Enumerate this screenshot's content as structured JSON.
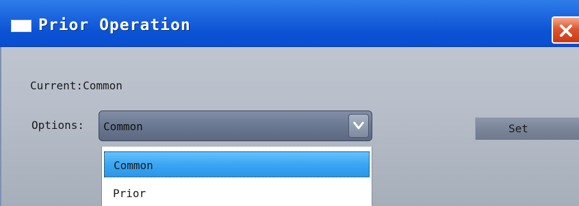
{
  "window": {
    "title": "Prior Operation"
  },
  "current": {
    "text": "Current:Common"
  },
  "options": {
    "label": "Options:",
    "selected": "Common",
    "items": [
      "Common",
      "Prior"
    ]
  },
  "set_button": {
    "label": "Set"
  },
  "icons": {
    "window": "window-icon",
    "close": "close-icon",
    "dropdown": "chevron-down-icon"
  },
  "colors": {
    "titlebar": "#0b52d4",
    "close": "#e0552d",
    "selection": "#3aa6f3"
  }
}
